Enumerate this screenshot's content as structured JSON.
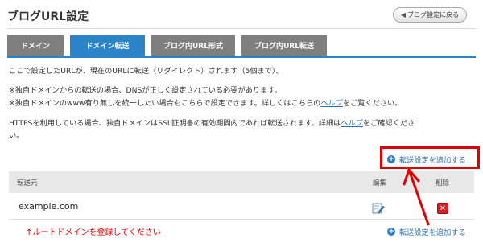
{
  "header": {
    "title": "ブログURL設定",
    "back_button": "ブログ設定に戻る"
  },
  "tabs": [
    {
      "label": "ドメイン",
      "active": false
    },
    {
      "label": "ドメイン転送",
      "active": true
    },
    {
      "label": "ブログ内URL形式",
      "active": false
    },
    {
      "label": "ブログ内URL転送",
      "active": false
    }
  ],
  "description": {
    "line1": "ここで設定したURLが、現在のURLに転送（リダイレクト）されます（5個まで）。",
    "note1": "※独自ドメインからの転送の場合、DNSが正しく設定されている必要があります。",
    "note2_before": "※独自ドメインのwww有り無しを統一したい場合もこちらで設定できます。詳しくはこちらの",
    "note2_link": "ヘルプ",
    "note2_after": "をご覧ください。",
    "https_before": "HTTPSを利用している場合、独自ドメインはSSL証明書の有効期間内であれば転送されます。詳細は",
    "https_link": "ヘルプ",
    "https_after": "をご確認くださ",
    "https_line2": "い。"
  },
  "add_link_top": "転送設定を追加する",
  "add_link_bottom": "転送設定を追加する",
  "table": {
    "headers": {
      "source": "転送元",
      "edit": "編集",
      "delete": "削除"
    },
    "rows": [
      {
        "source": "example.com"
      }
    ]
  },
  "annotation": "↑ルートドメインを登録してください",
  "colors": {
    "tab_active": "#2b84c8",
    "tab_inactive": "#7f7f7f",
    "highlight": "#e00000",
    "link": "#2a6fb0"
  }
}
